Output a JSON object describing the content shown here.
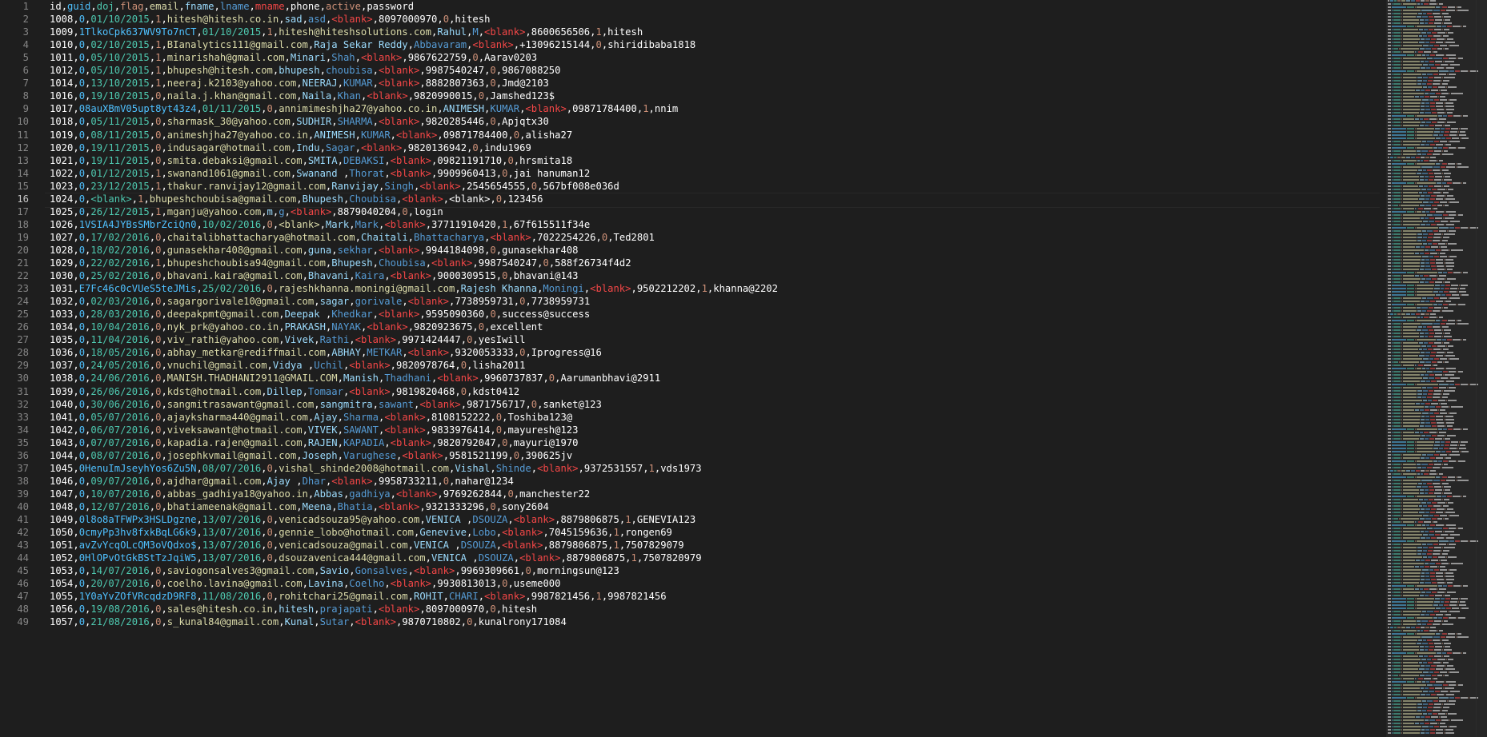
{
  "editor": {
    "active_line": 16,
    "lines": [
      "id,guid,doj,flag,email,fname,lname,mname,phone,active,password",
      "1008,0,01/10/2015,1,hitesh@hitesh.co.in,sad,asd,<blank>,8097000970,0,hitesh",
      "1009,1TlkoCpk637WV9To7nCT,01/10/2015,1,hitesh@hiteshsolutions.com,Rahul,M,<blank>,8600656506,1,hitesh",
      "1010,0,02/10/2015,1,BIanalytics111@gmail.com,Raja Sekar Reddy,Abbavaram,<blank>,+13096215144,0,shiridibaba1818",
      "1011,0,05/10/2015,1,minarishah@gmail.com,Minari,Shah,<blank>,9867622759,0,Aarav0203",
      "1012,0,05/10/2015,1,bhupesh@hitesh.com,bhupesh,choubisa,<blank>,9987540247,0,9867088250",
      "1014,0,13/10/2015,1,neeraj.k2103@yahoo.com,NEERAJ,KUMAR,<blank>,8882807363,0,Jmd@2103",
      "1016,0,19/10/2015,0,naila.j.khan@gmail.com,Naila,Khan,<blank>,9820990015,0,Jamshed123$",
      "1017,08auXBmV05upt8yt43z4,01/11/2015,0,annimimeshjha27@yahoo.co.in,ANIMESH,KUMAR,<blank>,09871784400,1,nnim",
      "1018,0,05/11/2015,0,sharmask_30@yahoo.com,SUDHIR,SHARMA,<blank>,9820285446,0,Apjqtx30",
      "1019,0,08/11/2015,0,animeshjha27@yahoo.co.in,ANIMESH,KUMAR,<blank>,09871784400,0,alisha27",
      "1020,0,19/11/2015,0,indusagar@hotmail.com,Indu,Sagar,<blank>,9820136942,0,indu1969",
      "1021,0,19/11/2015,0,smita.debaksi@gmail.com,SMITA,DEBAKSI,<blank>,09821191710,0,hrsmita18",
      "1022,0,01/12/2015,1,swanand1061@gmail.com,Swanand ,Thorat,<blank>,9909960413,0,jai hanuman12",
      "1023,0,23/12/2015,1,thakur.ranvijay12@gmail.com,Ranvijay,Singh,<blank>,2545654555,0,567bf008e036d",
      "1024,0,<blank>,1,bhupeshchoubisa@gmail.com,Bhupesh,Choubisa,<blank>,<blank>,0,123456",
      "1025,0,26/12/2015,1,mganju@yahoo.com,m,g,<blank>,8879040204,0,login",
      "1026,1VSIA4JYBsSMbrZciQn0,10/02/2016,0,<blank>,Mark,Mark,<blank>,37711910420,1,67f615511f34e",
      "1027,0,17/02/2016,0,chaitalibhattacharya@hotmail.com,Chaitali,Bhattacharya,<blank>,7022254226,0,Ted2801",
      "1028,0,18/02/2016,0,gunasekhar408@gmail.com,guna,sekhar,<blank>,9944184098,0,gunasekhar408",
      "1029,0,22/02/2016,1,bhupeshchoubisa94@gmail.com,Bhupesh,Choubisa,<blank>,9987540247,0,588f26734f4d2",
      "1030,0,25/02/2016,0,bhavani.kaira@gmail.com,Bhavani,Kaira,<blank>,9000309515,0,bhavani@143",
      "1031,E7Fc46c0cVUeS5teJMis,25/02/2016,0,rajeshkhanna.moningi@gmail.com,Rajesh Khanna,Moningi,<blank>,9502212202,1,khanna@2202",
      "1032,0,02/03/2016,0,sagargorivale10@gmail.com,sagar,gorivale,<blank>,7738959731,0,7738959731",
      "1033,0,28/03/2016,0,deepakpmt@gmail.com,Deepak ,Khedkar,<blank>,9595090360,0,success@success",
      "1034,0,10/04/2016,0,nyk_prk@yahoo.co.in,PRAKASH,NAYAK,<blank>,9820923675,0,excellent",
      "1035,0,11/04/2016,0,viv_rathi@yahoo.com,Vivek,Rathi,<blank>,9971424447,0,yesIwill",
      "1036,0,18/05/2016,0,abhay_metkar@rediffmail.com,ABHAY,METKAR,<blank>,9320053333,0,Iprogress@16",
      "1037,0,24/05/2016,0,vnuchil@gmail.com,Vidya ,Uchil,<blank>,9820978764,0,lisha2011",
      "1038,0,24/06/2016,0,MANISH.THADHANI2911@GMAIL.COM,Manish,Thadhani,<blank>,9960737837,0,Aarumanbhavi@2911",
      "1039,0,26/06/2016,0,kdst@hotmail.com,Dillep,Tomaar,<blank>,9819820468,0,kdst0412",
      "1040,0,30/06/2016,0,sangmitrasawant@gmail.com,sangmitra,sawant,<blank>,9871756717,0,sanket@123",
      "1041,0,05/07/2016,0,ajayksharma440@gmail.com,Ajay,Sharma,<blank>,8108152222,0,Toshiba123@",
      "1042,0,06/07/2016,0,viveksawant@hotmail.com,VIVEK,SAWANT,<blank>,9833976414,0,mayuresh@123",
      "1043,0,07/07/2016,0,kapadia.rajen@gmail.com,RAJEN,KAPADIA,<blank>,9820792047,0,mayuri@1970",
      "1044,0,08/07/2016,0,josephkvmail@gmail.com,Joseph,Varughese,<blank>,9581521199,0,390625jv",
      "1045,0HenuImJseyhYos6Zu5N,08/07/2016,0,vishal_shinde2008@hotmail.com,Vishal,Shinde,<blank>,9372531557,1,vds1973",
      "1046,0,09/07/2016,0,ajdhar@gmail.com,Ajay ,Dhar,<blank>,9958733211,0,nahar@1234",
      "1047,0,10/07/2016,0,abbas_gadhiya18@yahoo.in,Abbas,gadhiya,<blank>,9769262844,0,manchester22",
      "1048,0,12/07/2016,0,bhatiameenak@gmail.com,Meena,Bhatia,<blank>,9321333296,0,sony2604",
      "1049,0l8o8aTFWPx3HSLDgzne,13/07/2016,0,venicadsouza95@yahoo.com,VENICA ,DSOUZA,<blank>,8879806875,1,GENEVIA123",
      "1050,0cmyPp3hv8fxkBqLG6k9,13/07/2016,0,gennie_lobo@hotmail.com,Genevive,Lobo,<blank>,7045159636,1,rongen69",
      "1051,avZvYcqOLcQM3oVQdxo$,13/07/2016,0,venicadsouza@gmail.com,VENICA ,DSOUZA,<blank>,8879806875,1,7507829079",
      "1052,0HlOPvOtGkBStTzJqiW5,13/07/2016,0,dsouzavenica444@gmail.com,VENICA ,DSOUZA,<blank>,8879806875,1,7507820979",
      "1053,0,14/07/2016,0,saviogonsalves3@gmail.com,Savio,Gonsalves,<blank>,9969309661,0,morningsun@123",
      "1054,0,20/07/2016,0,coelho.lavina@gmail.com,Lavina,Coelho,<blank>,9930813013,0,useme000",
      "1055,1Y0aYvZOfVRcqdzD9RF8,11/08/2016,0,rohitchari25@gmail.com,ROHIT,CHARI,<blank>,9987821456,1,9987821456",
      "1056,0,19/08/2016,0,sales@hitesh.co.in,hitesh,prajapati,<blank>,8097000970,0,hitesh",
      "1057,0,21/08/2016,0,s_kunal84@gmail.com,Kunal,Sutar,<blank>,9870710802,0,kunalrony171084"
    ],
    "column_colors": [
      "#ffffff",
      "#4fc1ff",
      "#4ec9b0",
      "#ce9178",
      "#dcdcaa",
      "#9cdcfe",
      "#569cd6",
      "#f44747",
      "#ffffff",
      "#ce9178"
    ]
  }
}
